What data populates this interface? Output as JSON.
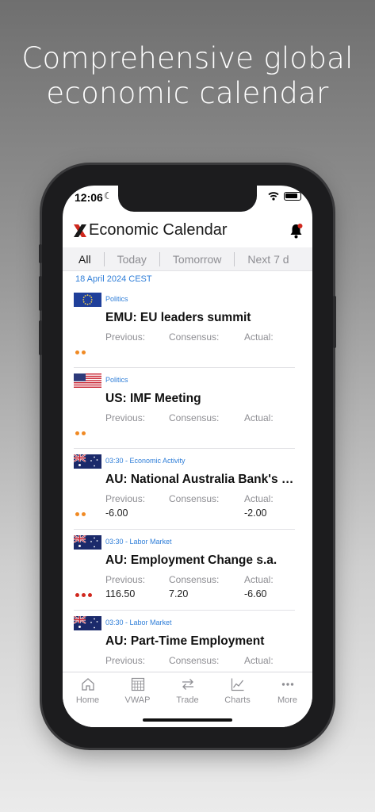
{
  "headline": {
    "line1": "Comprehensive global",
    "line2": "economic calendar"
  },
  "status_bar": {
    "time": "12:06"
  },
  "header": {
    "title": "Economic Calendar",
    "logo_icon": "x-logo-icon",
    "bell_icon": "bell-icon"
  },
  "tabs": [
    "All",
    "Today",
    "Tomorrow",
    "Next 7 d"
  ],
  "active_tab": "All",
  "date_label": "18 April 2024 CEST",
  "column_labels": {
    "previous": "Previous:",
    "consensus": "Consensus:",
    "actual": "Actual:"
  },
  "events": [
    {
      "flag": "eu-flag",
      "category": "Politics",
      "title": "EMU: EU leaders summit",
      "previous": "",
      "consensus": "",
      "actual": "",
      "impact": 2
    },
    {
      "flag": "us-flag",
      "category": "Politics",
      "title": "US: IMF Meeting",
      "previous": "",
      "consensus": "",
      "actual": "",
      "impact": 2
    },
    {
      "flag": "au-flag",
      "category": "03:30 - Economic Activity",
      "title": "AU: National Australia Bank's Business Confidence",
      "previous": "-6.00",
      "consensus": "",
      "actual": "-2.00",
      "impact": 2
    },
    {
      "flag": "au-flag",
      "category": "03:30 - Labor Market",
      "title": "AU: Employment Change s.a.",
      "previous": "116.50",
      "consensus": "7.20",
      "actual": "-6.60",
      "impact": 3
    },
    {
      "flag": "au-flag",
      "category": "03:30 - Labor Market",
      "title": "AU: Part-Time Employment",
      "previous": "",
      "consensus": "",
      "actual": "",
      "impact": 0
    }
  ],
  "tabbar": [
    {
      "label": "Home",
      "icon": "home-icon"
    },
    {
      "label": "VWAP",
      "icon": "grid-icon"
    },
    {
      "label": "Trade",
      "icon": "swap-arrows-icon"
    },
    {
      "label": "Charts",
      "icon": "chart-icon"
    },
    {
      "label": "More",
      "icon": "more-dots-icon"
    }
  ],
  "colors": {
    "accent_blue": "#2f7ed8",
    "impact_orange": "#f08a24",
    "impact_red": "#d0281e",
    "logo_red": "#d0281e"
  }
}
